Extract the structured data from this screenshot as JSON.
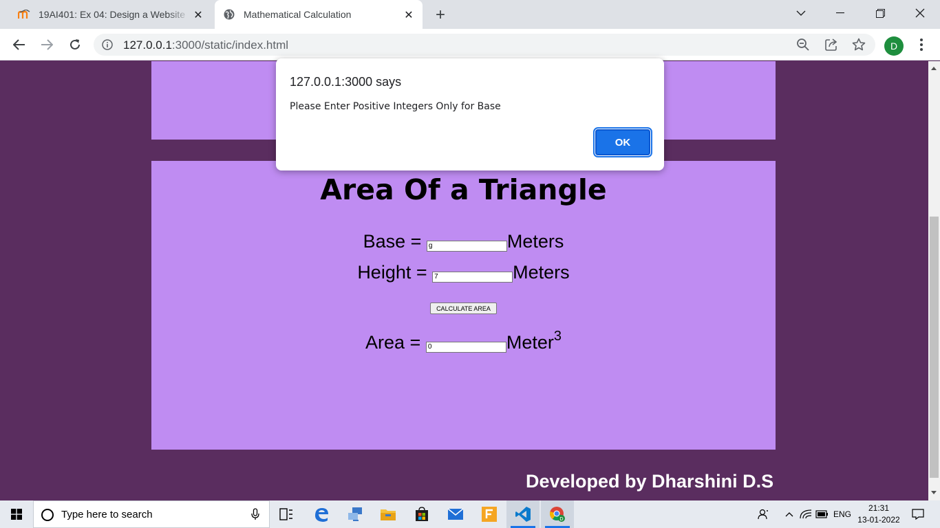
{
  "browser": {
    "tabs": [
      {
        "title": "19AI401: Ex 04: Design a Website",
        "active": false
      },
      {
        "title": "Mathematical Calculation",
        "active": true
      }
    ],
    "url_host": "127.0.0.1",
    "url_rest": ":3000/static/index.html",
    "avatar_letter": "D"
  },
  "page": {
    "heading": "Area Of a Triangle",
    "base_label": "Base =",
    "base_value": "g",
    "base_unit": "Meters",
    "height_label": "Height =",
    "height_value": "7",
    "height_unit": "Meters",
    "calculate_label": "CALCULATE AREA",
    "area_label": "Area =",
    "area_value": "0",
    "area_unit": "Meter",
    "area_unit_sup": "3",
    "credit": "Developed by Dharshini D.S",
    "background_color": "#5a2d5f",
    "panel_color": "#bf8cf2"
  },
  "dialog": {
    "title": "127.0.0.1:3000 says",
    "message": "Please Enter Positive Integers Only for Base",
    "ok_label": "OK",
    "accent": "#1a73e8"
  },
  "taskbar": {
    "search_placeholder": "Type here to search",
    "language": "ENG",
    "time": "21:31",
    "date": "13-01-2022",
    "apps": [
      "task-view-icon",
      "edge-icon",
      "network-app-icon",
      "file-explorer-icon",
      "store-icon",
      "mail-icon",
      "f-app-icon",
      "vscode-icon",
      "chrome-icon"
    ]
  }
}
